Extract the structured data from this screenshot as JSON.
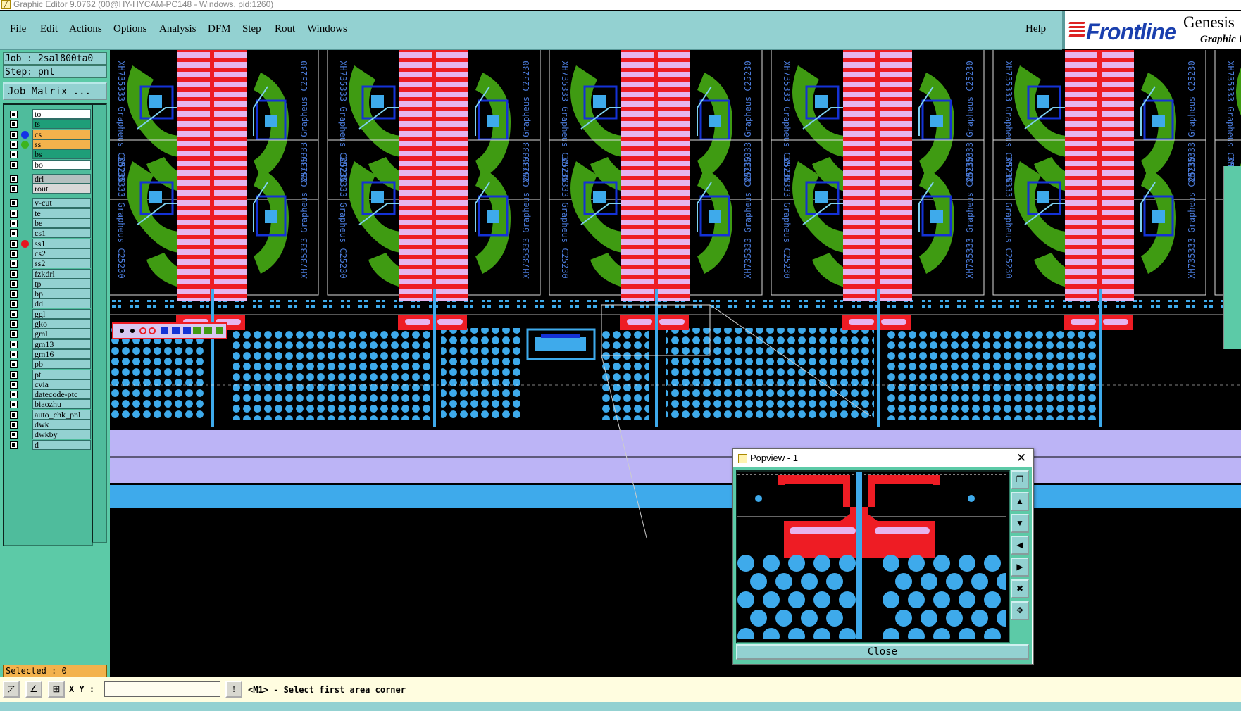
{
  "window": {
    "title": "Graphic Editor 9.0762 (00@HY-HYCAM-PC148 - Windows, pid:1260)"
  },
  "menu": {
    "items": [
      "File",
      "Edit",
      "Actions",
      "Options",
      "Analysis",
      "DFM",
      "Step",
      "Rout",
      "Windows"
    ],
    "help": "Help"
  },
  "logo": {
    "brand": "Frontline",
    "product": "Genesis",
    "subtitle": "Graphic Editor"
  },
  "job": {
    "job_line": "Job : 2sal800ta0",
    "step_line": "Step: pnl",
    "matrix_button": "Job Matrix ..."
  },
  "layers": [
    {
      "name": "to",
      "bg": "#ffffff",
      "dot": ""
    },
    {
      "name": "ts",
      "bg": "#1e9e78",
      "dot": ""
    },
    {
      "name": "cs",
      "bg": "#f3b24c",
      "dot": "#1432e6"
    },
    {
      "name": "ss",
      "bg": "#f3b24c",
      "dot": "#3cb41e"
    },
    {
      "name": "bs",
      "bg": "#1e9e78",
      "dot": ""
    },
    {
      "name": "bo",
      "bg": "#ffffff",
      "dot": ""
    },
    {
      "name": "drl",
      "bg": "#b4c0c0",
      "dot": ""
    },
    {
      "name": "rout",
      "bg": "#d8d8d8",
      "dot": ""
    },
    {
      "name": "v-cut",
      "bg": "#93d1d1",
      "dot": ""
    },
    {
      "name": "te",
      "bg": "#93d1d1",
      "dot": ""
    },
    {
      "name": "be",
      "bg": "#93d1d1",
      "dot": ""
    },
    {
      "name": "cs1",
      "bg": "#93d1d1",
      "dot": ""
    },
    {
      "name": "ss1",
      "bg": "#93d1d1",
      "dot": "#e6141e"
    },
    {
      "name": "cs2",
      "bg": "#93d1d1",
      "dot": ""
    },
    {
      "name": "ss2",
      "bg": "#93d1d1",
      "dot": ""
    },
    {
      "name": "fzkdrl",
      "bg": "#93d1d1",
      "dot": ""
    },
    {
      "name": "tp",
      "bg": "#93d1d1",
      "dot": ""
    },
    {
      "name": "bp",
      "bg": "#93d1d1",
      "dot": ""
    },
    {
      "name": "dd",
      "bg": "#93d1d1",
      "dot": ""
    },
    {
      "name": "ggl",
      "bg": "#93d1d1",
      "dot": ""
    },
    {
      "name": "gko",
      "bg": "#93d1d1",
      "dot": ""
    },
    {
      "name": "gml",
      "bg": "#93d1d1",
      "dot": ""
    },
    {
      "name": "gm13",
      "bg": "#93d1d1",
      "dot": ""
    },
    {
      "name": "gm16",
      "bg": "#93d1d1",
      "dot": ""
    },
    {
      "name": "pb",
      "bg": "#93d1d1",
      "dot": ""
    },
    {
      "name": "pt",
      "bg": "#93d1d1",
      "dot": ""
    },
    {
      "name": "cvia",
      "bg": "#93d1d1",
      "dot": ""
    },
    {
      "name": "datecode-ptc",
      "bg": "#93d1d1",
      "dot": ""
    },
    {
      "name": "biaozhu",
      "bg": "#93d1d1",
      "dot": ""
    },
    {
      "name": "auto_chk_pnl",
      "bg": "#93d1d1",
      "dot": ""
    },
    {
      "name": "dwk",
      "bg": "#93d1d1",
      "dot": ""
    },
    {
      "name": "dwkby",
      "bg": "#93d1d1",
      "dot": ""
    },
    {
      "name": "d",
      "bg": "#93d1d1",
      "dot": ""
    }
  ],
  "selection": {
    "text": "Selected : 0"
  },
  "command": {
    "xy_label": "X Y :",
    "xy_value": "",
    "status": "<M1> - Select first area corner"
  },
  "popview": {
    "title": "Popview - 1",
    "close_label": "Close"
  },
  "board": {
    "silk_text": "XH735333 Grapheus C25230"
  },
  "colors": {
    "panel_bg": "#5ccaa7",
    "menu_bg": "#93d1d1",
    "copper_red": "#ee1c24",
    "pad_pink": "#e7b4ee",
    "via_blue": "#3eaaeb",
    "trace_green": "#3f9b12",
    "trace_blue": "#1432d6",
    "band_lavender": "#bcb4f6",
    "band_blue": "#3eaaeb"
  },
  "icons": {
    "popview_tools": [
      "zoom-fit-icon",
      "pan-up-icon",
      "pan-down-icon",
      "pan-left-icon",
      "pan-right-icon",
      "zoom-in-icon",
      "zoom-out-icon"
    ]
  }
}
